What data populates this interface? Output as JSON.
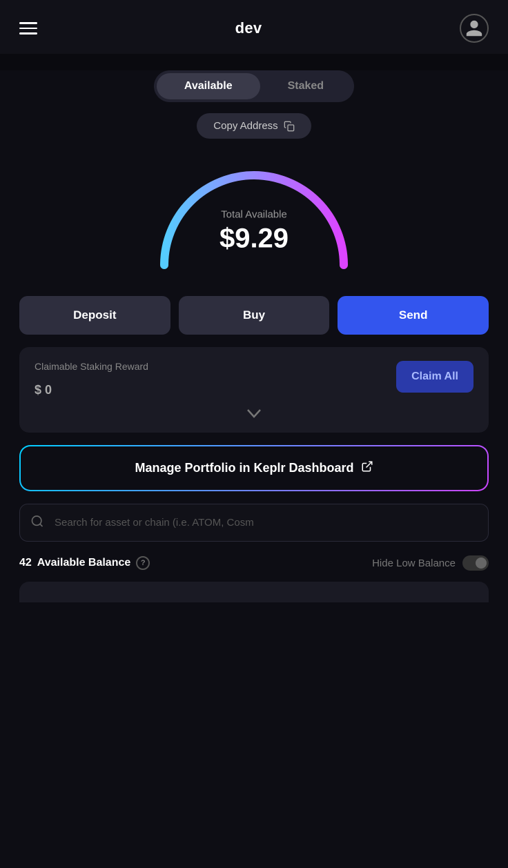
{
  "header": {
    "title": "dev",
    "avatar_label": "user avatar"
  },
  "tabs": {
    "available_label": "Available",
    "staked_label": "Staked",
    "active": "available"
  },
  "copy_address": {
    "label": "Copy Address"
  },
  "gauge": {
    "label": "Total Available",
    "value": "$9.29"
  },
  "actions": {
    "deposit": "Deposit",
    "buy": "Buy",
    "send": "Send"
  },
  "staking": {
    "label": "Claimable Staking Reward",
    "value": "$ 0",
    "claim_btn": "Claim All"
  },
  "portfolio": {
    "label": "Manage Portfolio in Keplr Dashboard"
  },
  "search": {
    "placeholder": "Search for asset or chain (i.e. ATOM, Cosm"
  },
  "balance": {
    "count": "42",
    "label": "Available Balance",
    "hide_low_label": "Hide Low Balance"
  }
}
